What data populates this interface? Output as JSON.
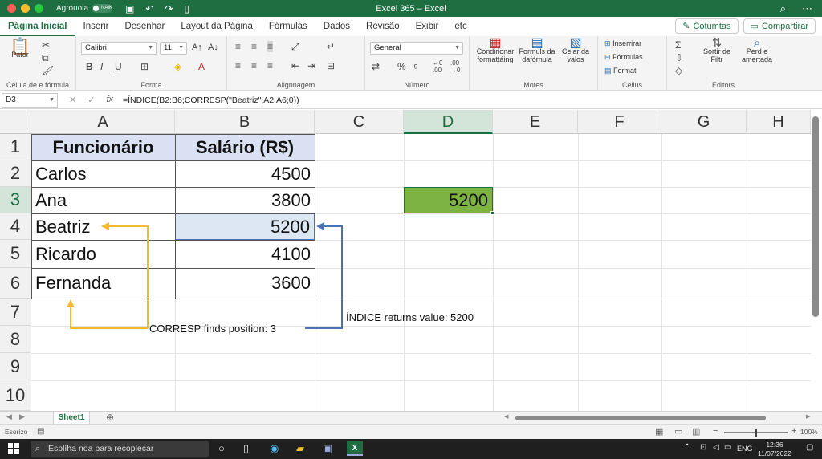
{
  "titlebar": {
    "autosave_label": "Agrouoia",
    "toggle_label": "NAIK",
    "title": "Excel 365 – Excel"
  },
  "tabs": [
    "Página Inicial",
    "Inserir",
    "Desenhar",
    "Layout da Página",
    "Fórmulas",
    "Dados",
    "Revisão",
    "Exibir",
    "etc"
  ],
  "tab_buttons": {
    "comments": "Cotumtas",
    "share": "Compartirar"
  },
  "ribbon": {
    "paste_label": "Pator",
    "clipboard_group": "Célula de e fórmula",
    "font_name": "Calibri",
    "font_size": "11",
    "font_group": "Forma",
    "alignment_group": "Alignnagem",
    "number_format": "General",
    "number_group": "Número",
    "cond_format": "Condirionar formattáing",
    "format_as": "Formuls da dafórnula",
    "cell_styles": "Celar da valos",
    "styles_group": "Motes",
    "insert": "Inserrirar",
    "formulas": "Fórmulas",
    "format": "Format",
    "cells_group": "Ceilus",
    "sort_filter": "Sortir de Filtr",
    "find_select": "Perd e amertada",
    "editing_group": "Editors"
  },
  "formula_bar": {
    "name_box": "D3",
    "formula": "=ÍNDICE(B2:B6;CORRESP(\"Beatriz\";A2:A6;0))"
  },
  "columns": [
    "A",
    "B",
    "C",
    "D",
    "E",
    "F",
    "G",
    "H"
  ],
  "rows": [
    "1",
    "2",
    "3",
    "4",
    "5",
    "6",
    "7",
    "8",
    "9",
    "10"
  ],
  "table": {
    "header_a": "Funcionário",
    "header_b": "Salário (R$)",
    "names": [
      "Carlos",
      "Ana",
      "Beatriz",
      "Ricardo",
      "Fernanda"
    ],
    "salaries": [
      "4500",
      "3800",
      "5200",
      "4100",
      "3600"
    ]
  },
  "result_cell": "5200",
  "annotations": {
    "corresp": "CORRESP finds position: 3",
    "indice": "ÍNDICE returns value: 5200",
    "yellow": "#f5b92b",
    "blue": "#4a72b0"
  },
  "sheet_tab": "Sheet1",
  "status": {
    "mode": "Esorizo",
    "zoom": "100%"
  },
  "taskbar": {
    "search_placeholder": "Esplíha noa para recoplecar",
    "lang": "ENG",
    "time": "12:36",
    "date": "11/07/2022"
  },
  "colors": {
    "brand": "#1e6e42",
    "header_fill": "#d9e1f2",
    "result_fill": "#7cb342",
    "selection_fill": "#dde6f3"
  }
}
